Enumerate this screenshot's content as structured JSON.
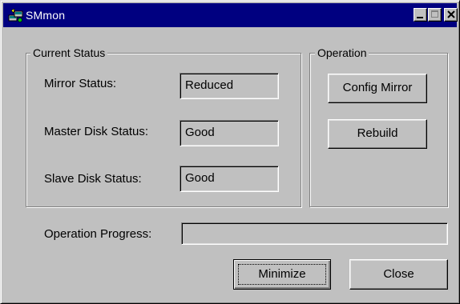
{
  "window": {
    "title": "SMmon",
    "icon": "smmon-app-icon",
    "title_bar_color": "#000080",
    "face_color": "#c0c0c0"
  },
  "current_status": {
    "group_title": "Current Status",
    "rows": [
      {
        "label": "Mirror Status:",
        "value": "Reduced"
      },
      {
        "label": "Master Disk Status:",
        "value": "Good"
      },
      {
        "label": "Slave Disk Status:",
        "value": "Good"
      }
    ]
  },
  "operation": {
    "group_title": "Operation",
    "config_mirror_label": "Config Mirror",
    "rebuild_label": "Rebuild"
  },
  "progress": {
    "label": "Operation Progress:",
    "value": 0
  },
  "footer": {
    "minimize_label": "Minimize",
    "close_label": "Close"
  }
}
